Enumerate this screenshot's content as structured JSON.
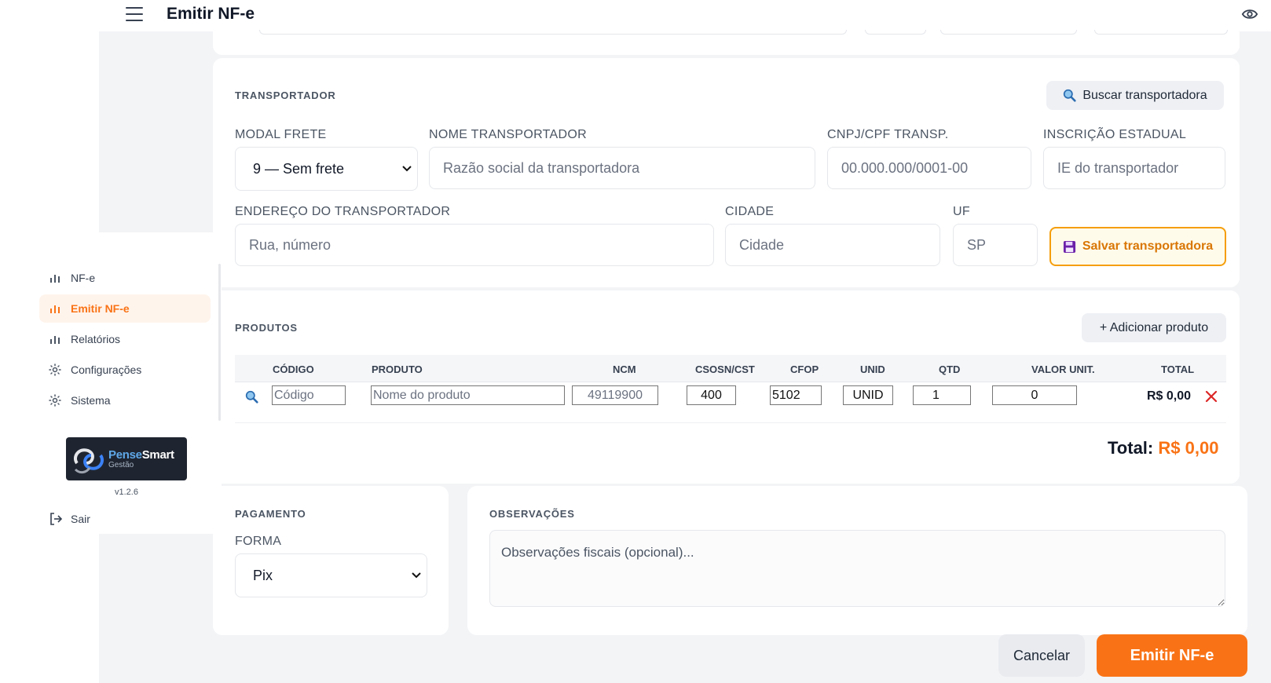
{
  "header": {
    "title": "Emitir NF-e"
  },
  "sidebar": {
    "items": [
      {
        "label": "NF-e",
        "icon": "bar-chart-icon",
        "active": false
      },
      {
        "label": "Emitir NF-e",
        "icon": "bar-chart-icon",
        "active": true
      },
      {
        "label": "Relatórios",
        "icon": "bar-chart-icon",
        "active": false
      },
      {
        "label": "Configurações",
        "icon": "gear-icon",
        "active": false
      },
      {
        "label": "Sistema",
        "icon": "gear-icon",
        "active": false
      }
    ],
    "logo": {
      "name_part1": "Pense",
      "name_part2": "Smart",
      "sub": "Gestão"
    },
    "version": "v1.2.6",
    "logout_label": "Sair"
  },
  "transportador": {
    "section_title": "TRANSPORTADOR",
    "search_button": "Buscar transportadora",
    "modal_frete": {
      "label": "MODAL FRETE",
      "value": "9 — Sem frete"
    },
    "nome": {
      "label": "NOME TRANSPORTADOR",
      "placeholder": "Razão social da transportadora",
      "value": ""
    },
    "cnpj": {
      "label": "CNPJ/CPF TRANSP.",
      "placeholder": "00.000.000/0001-00",
      "value": ""
    },
    "ie": {
      "label": "INSCRIÇÃO ESTADUAL",
      "placeholder": "IE do transportador",
      "value": ""
    },
    "endereco": {
      "label": "ENDEREÇO DO TRANSPORTADOR",
      "placeholder": "Rua, número",
      "value": ""
    },
    "cidade": {
      "label": "CIDADE",
      "placeholder": "Cidade",
      "value": ""
    },
    "uf": {
      "label": "UF",
      "placeholder": "SP",
      "value": ""
    },
    "save_button": "Salvar transportadora"
  },
  "produtos": {
    "section_title": "PRODUTOS",
    "add_button": "+ Adicionar produto",
    "columns": [
      "CÓDIGO",
      "PRODUTO",
      "NCM",
      "CSOSN/CST",
      "CFOP",
      "UNID",
      "QTD",
      "VALOR UNIT.",
      "TOTAL"
    ],
    "row": {
      "codigo": {
        "placeholder": "Código",
        "value": ""
      },
      "produto": {
        "placeholder": "Nome do produto",
        "value": ""
      },
      "ncm": {
        "placeholder": "49119900",
        "value": ""
      },
      "csosn": "400",
      "cfop": "5102",
      "unid": "UNID",
      "qtd": "1",
      "valor_unit": "0",
      "total": "R$ 0,00"
    },
    "total_label": "Total:",
    "total_value": "R$ 0,00"
  },
  "pagamento": {
    "section_title": "PAGAMENTO",
    "forma_label": "FORMA",
    "forma_value": "Pix"
  },
  "observacoes": {
    "section_title": "OBSERVAÇÕES",
    "placeholder": "Observações fiscais (opcional)...",
    "value": ""
  },
  "actions": {
    "cancel": "Cancelar",
    "emit": "Emitir NF-e"
  },
  "colors": {
    "accent": "#f97316",
    "save_border": "#f59e0b",
    "background": "#f3f4f6"
  }
}
